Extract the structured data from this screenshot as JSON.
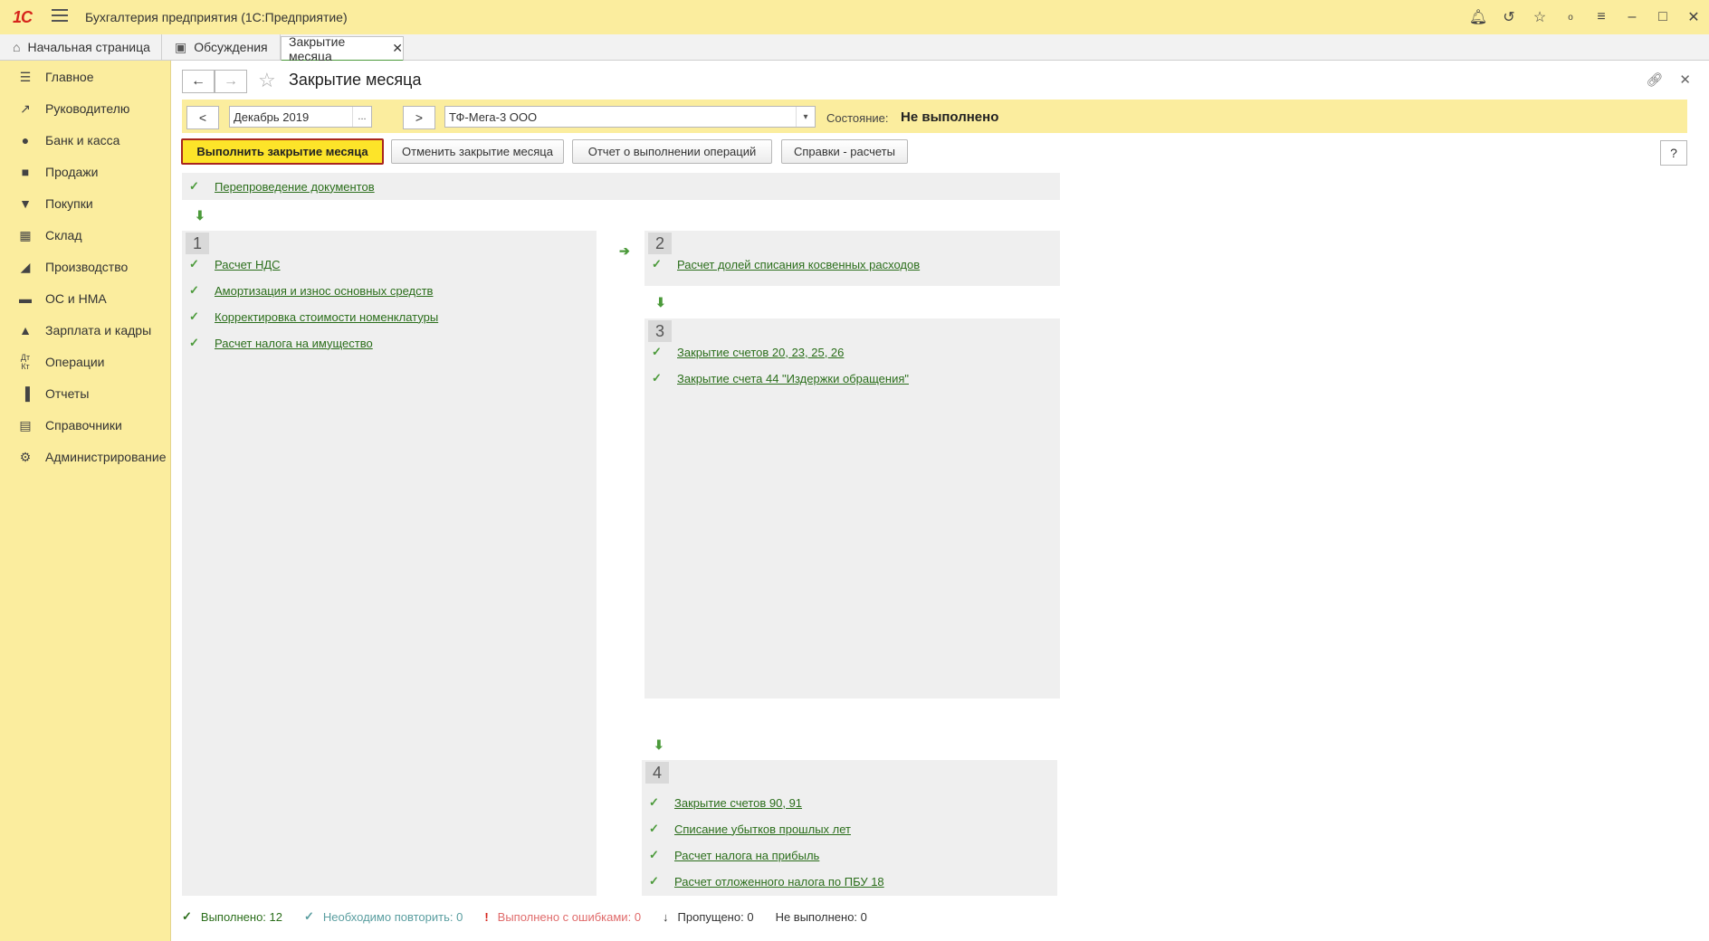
{
  "app": {
    "logo": "1С",
    "title": "Бухгалтерия предприятия  (1С:Предприятие)"
  },
  "titlebar_icons": [
    "bell-icon",
    "history-icon",
    "star-icon",
    "dot-icon",
    "settings-lines-icon",
    "minimize-icon",
    "maximize-icon",
    "close-icon"
  ],
  "tabs": [
    {
      "label": "Начальная страница",
      "icon": "home-icon"
    },
    {
      "label": "Обсуждения",
      "icon": "chat-icon"
    },
    {
      "label": "Закрытие месяца",
      "icon": "close-icon"
    }
  ],
  "sidebar": {
    "items": [
      {
        "label": "Главное",
        "icon": "list-icon"
      },
      {
        "label": "Руководителю",
        "icon": "trend-icon"
      },
      {
        "label": "Банк и касса",
        "icon": "ruble-icon"
      },
      {
        "label": "Продажи",
        "icon": "bag-icon"
      },
      {
        "label": "Покупки",
        "icon": "cart-icon"
      },
      {
        "label": "Склад",
        "icon": "grid-icon"
      },
      {
        "label": "Производство",
        "icon": "factory-icon"
      },
      {
        "label": "ОС и НМА",
        "icon": "truck-icon"
      },
      {
        "label": "Зарплата и кадры",
        "icon": "person-icon"
      },
      {
        "label": "Операции",
        "icon": "dt-kt-icon"
      },
      {
        "label": "Отчеты",
        "icon": "bar-chart-icon"
      },
      {
        "label": "Справочники",
        "icon": "book-icon"
      },
      {
        "label": "Администрирование",
        "icon": "gear-icon"
      }
    ]
  },
  "page": {
    "title": "Закрытие месяца"
  },
  "filter": {
    "prev": "<",
    "period": "Декабрь 2019",
    "period_btn": "...",
    "next": ">",
    "organization": "ТФ-Мега-3 ООО",
    "state_label": "Состояние:",
    "state_value": "Не выполнено"
  },
  "actions": {
    "execute": "Выполнить закрытие месяца",
    "cancel": "Отменить закрытие месяца",
    "report": "Отчет о выполнении операций",
    "info": "Справки - расчеты",
    "help": "?"
  },
  "pre_step": {
    "label": "Перепроведение документов"
  },
  "steps": [
    {
      "number": "1",
      "items": [
        "Расчет НДС",
        "Амортизация и износ основных средств",
        "Корректировка стоимости номенклатуры",
        "Расчет налога на имущество"
      ]
    },
    {
      "number": "2",
      "items": [
        "Расчет долей списания косвенных расходов"
      ]
    },
    {
      "number": "3",
      "items": [
        "Закрытие счетов 20, 23, 25, 26",
        "Закрытие счета 44 \"Издержки обращения\""
      ]
    },
    {
      "number": "4",
      "items": [
        "Закрытие счетов 90, 91",
        "Списание убытков прошлых лет",
        "Расчет налога на прибыль",
        "Расчет отложенного налога по ПБУ 18"
      ]
    }
  ],
  "status": {
    "done_label": "Выполнено:",
    "done_value": "12",
    "repeat_label": "Необходимо повторить:",
    "repeat_value": "0",
    "errors_label": "Выполнено с ошибками:",
    "errors_value": "0",
    "skipped_label": "Пропущено:",
    "skipped_value": "0",
    "notdone_label": "Не выполнено:",
    "notdone_value": "0"
  },
  "colors": {
    "accent_yellow": "#fbed9e",
    "link_green": "#2b6e1b",
    "check_green": "#4b9a3a",
    "primary_button": "#fde429",
    "error_red": "#e06b6b",
    "repeat_teal": "#5a9ea0"
  }
}
